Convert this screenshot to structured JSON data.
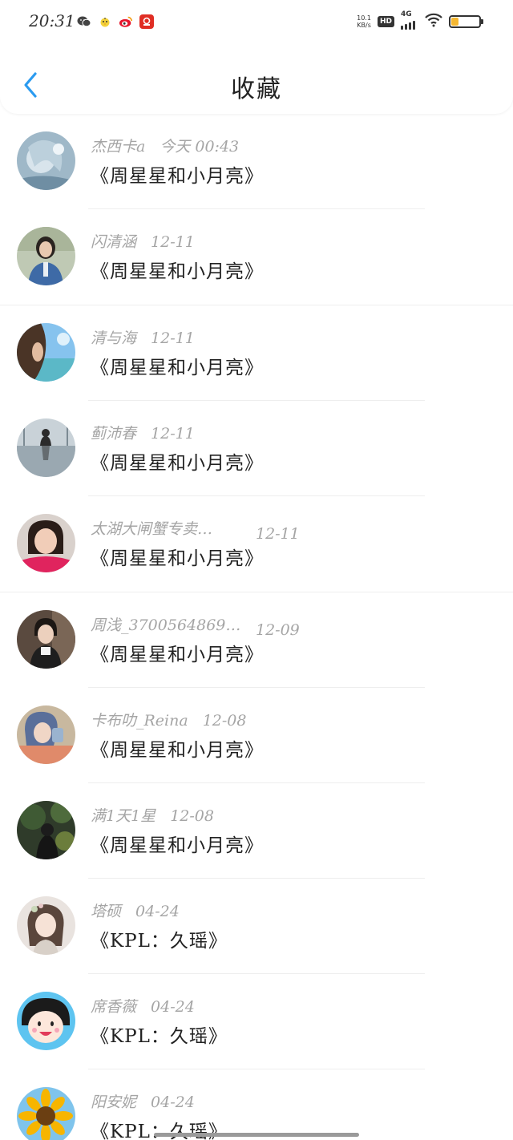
{
  "status_bar": {
    "time": "20:31",
    "net_speed_value": "10.1",
    "net_speed_unit": "KB/s",
    "hd_label": "HD",
    "network_type": "4G",
    "battery_level": 0.25,
    "app_icons": [
      "wechat-icon",
      "chick-icon",
      "weibo-icon",
      "pinduoduo-icon"
    ]
  },
  "header": {
    "title": "收藏",
    "back_icon": "chevron-left-icon",
    "accent_color": "#2b9bf0"
  },
  "items": [
    {
      "name": "杰西卡a",
      "date": "今天 00:43",
      "title": "《周星星和小月亮》",
      "avatar": "anime-girl-avatar"
    },
    {
      "name": "闪清涵",
      "date": "12-11",
      "title": "《周星星和小月亮》",
      "avatar": "woman-denim-avatar"
    },
    {
      "name": "清与海",
      "date": "12-11",
      "title": "《周星星和小月亮》",
      "avatar": "woman-sea-avatar"
    },
    {
      "name": "蓟沛春",
      "date": "12-11",
      "title": "《周星星和小月亮》",
      "avatar": "silhouette-reflection-avatar"
    },
    {
      "name": "太湖大闸蟹专卖…",
      "date": "12-11",
      "title": "《周星星和小月亮》",
      "avatar": "girl-red-avatar"
    },
    {
      "name": "周浅_3700564869…",
      "date": "12-09",
      "title": "《周星星和小月亮》",
      "avatar": "boy-headphones-avatar"
    },
    {
      "name": "卡布叻_Reina",
      "date": "12-08",
      "title": "《周星星和小月亮》",
      "avatar": "anime-blue-hair-avatar"
    },
    {
      "name": "满1天1星",
      "date": "12-08",
      "title": "《周星星和小月亮》",
      "avatar": "dark-forest-avatar"
    },
    {
      "name": "塔硕",
      "date": "04-24",
      "title": "《KPL：久瑶》",
      "avatar": "braided-girl-avatar"
    },
    {
      "name": "席香薇",
      "date": "04-24",
      "title": "《KPL：久瑶》",
      "avatar": "maruko-avatar"
    },
    {
      "name": "阳安妮",
      "date": "04-24",
      "title": "《KPL：久瑶》",
      "avatar": "sunflower-avatar"
    }
  ]
}
